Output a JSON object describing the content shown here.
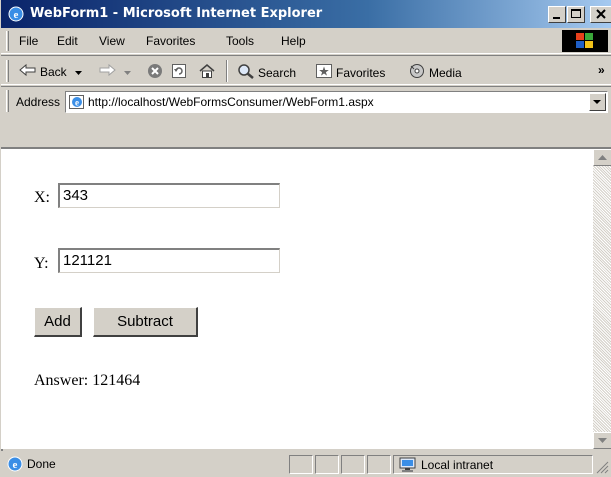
{
  "window": {
    "title": "WebForm1 - Microsoft Internet Explorer"
  },
  "menu": {
    "items": [
      "File",
      "Edit",
      "View",
      "Favorites",
      "Tools",
      "Help"
    ]
  },
  "toolbar": {
    "back_label": "Back",
    "search_label": "Search",
    "favorites_label": "Favorites",
    "media_label": "Media"
  },
  "address": {
    "label": "Address",
    "url": "http://localhost/WebFormsConsumer/WebForm1.aspx"
  },
  "form": {
    "x_label": "X:",
    "x_value": "343",
    "y_label": "Y:",
    "y_value": "121121",
    "add_label": "Add",
    "subtract_label": "Subtract",
    "answer_text": "Answer: 121464"
  },
  "status": {
    "text": "Done",
    "zone": "Local intranet"
  },
  "colors": {
    "title_gradient_start": "#0a246a",
    "title_gradient_end": "#a6caf0",
    "chrome": "#d4d0c8"
  }
}
